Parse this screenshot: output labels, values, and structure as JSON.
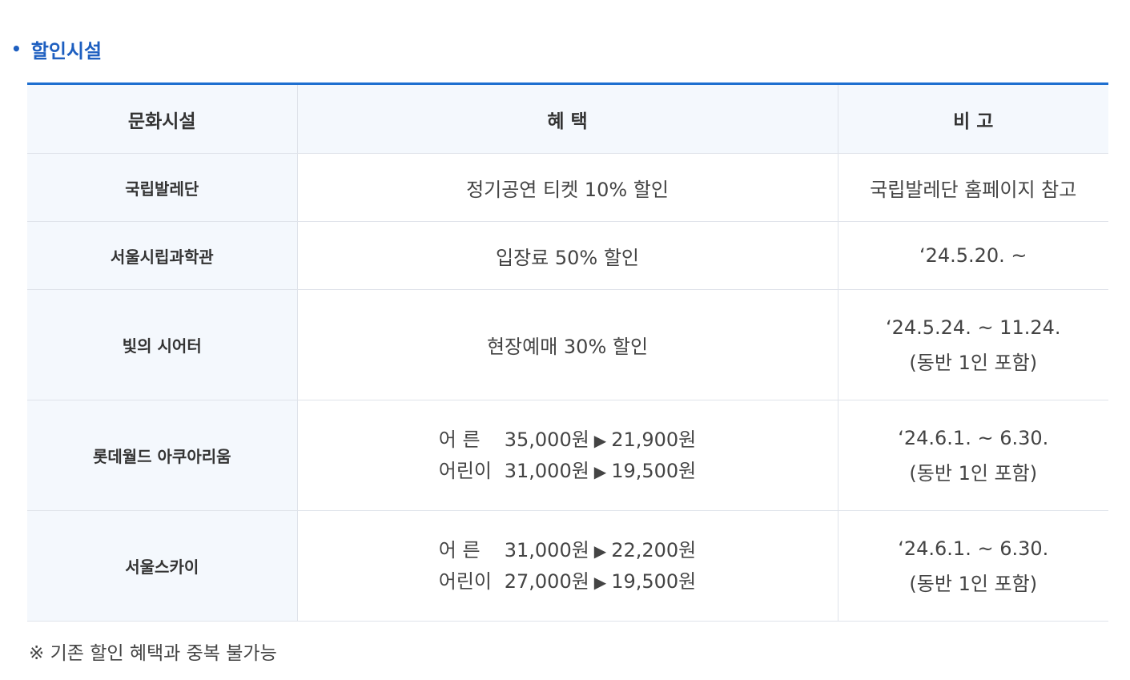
{
  "section": {
    "bullet": "•",
    "title": "할인시설"
  },
  "table": {
    "headers": [
      "문화시설",
      "혜 택",
      "비 고"
    ],
    "rows": [
      {
        "facility": "국립발레단",
        "benefit": "정기공연 티켓 10% 할인",
        "remark": "국립발레단 홈페이지 참고"
      },
      {
        "facility": "서울시립과학관",
        "benefit": "입장료 50% 할인",
        "remark": "‘24.5.20. ~"
      },
      {
        "facility": "빛의 시어터",
        "benefit": "현장예매 30% 할인",
        "remark_line1": "‘24.5.24. ~ 11.24.",
        "remark_line2": "(동반 1인 포함)"
      },
      {
        "facility": "롯데월드 아쿠아리움",
        "prices": [
          {
            "who": "어 른",
            "from": "35,000원",
            "arrow": "▶",
            "to": "21,900원"
          },
          {
            "who": "어린이",
            "from": "31,000원",
            "arrow": "▶",
            "to": "19,500원"
          }
        ],
        "remark_line1": "‘24.6.1. ~ 6.30.",
        "remark_line2": "(동반 1인 포함)"
      },
      {
        "facility": "서울스카이",
        "prices": [
          {
            "who": "어 른",
            "from": "31,000원",
            "arrow": "▶",
            "to": "22,200원"
          },
          {
            "who": "어린이",
            "from": "27,000원",
            "arrow": "▶",
            "to": "19,500원"
          }
        ],
        "remark_line1": "‘24.6.1. ~ 6.30.",
        "remark_line2": "(동반 1인 포함)"
      }
    ]
  },
  "note": "※ 기존 할인 혜택과 중복 불가능",
  "colors": {
    "accent": "#1e5fc0",
    "table_top_border": "#1e6fd0",
    "header_bg": "#f4f8fd"
  }
}
